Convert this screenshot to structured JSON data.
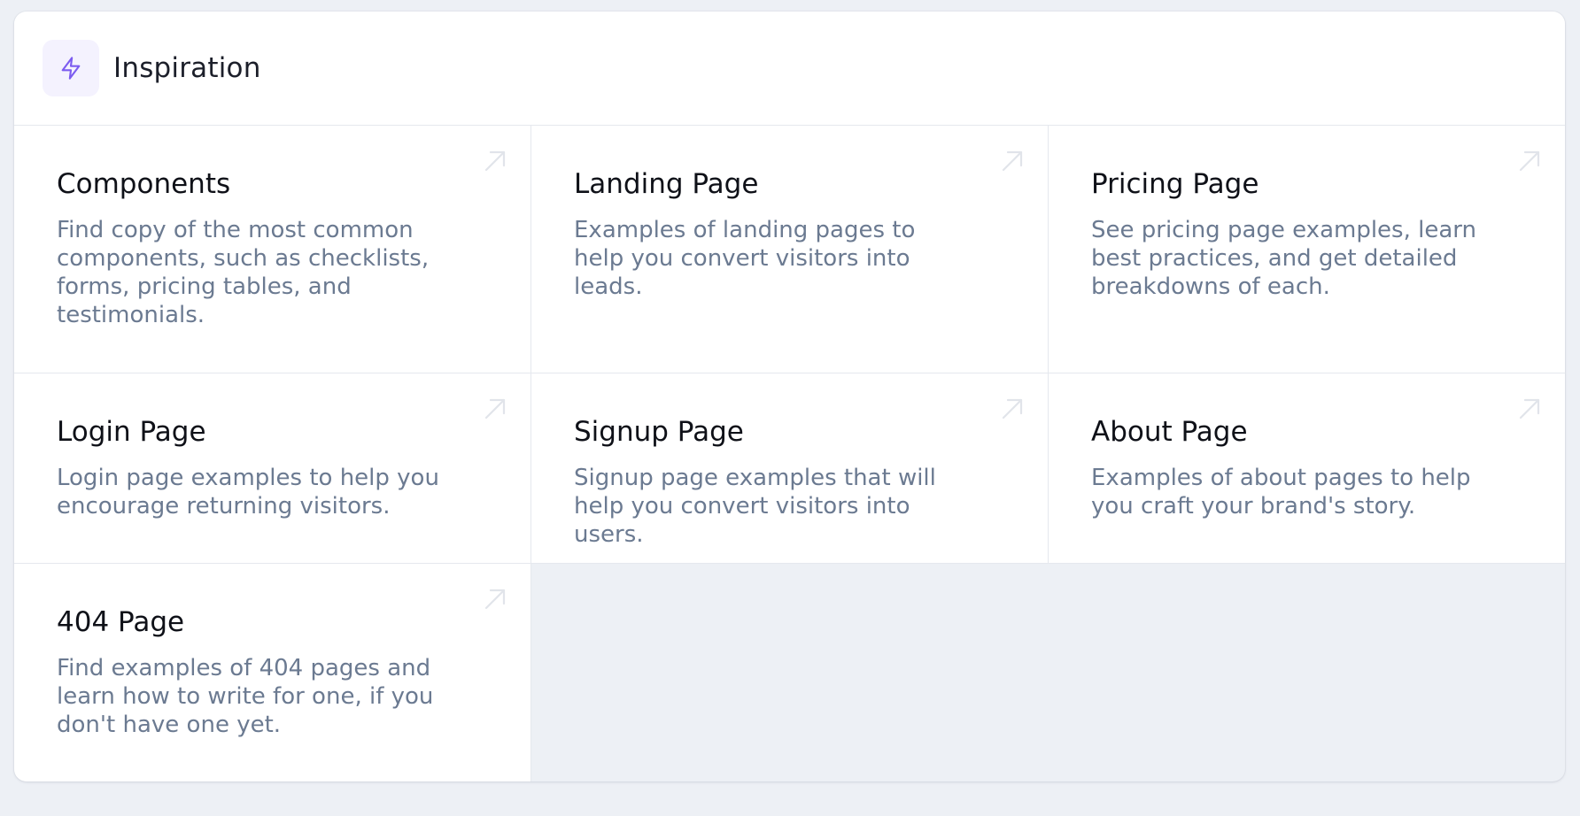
{
  "header": {
    "title": "Inspiration",
    "icon": "lightning-bolt-icon",
    "accent_color": "#7c5cf0"
  },
  "cards": [
    {
      "title": "Components",
      "description": "Find copy of the most common components, such as checklists, forms, pricing tables, and testimonials.",
      "icon": "arrow-up-right-icon"
    },
    {
      "title": "Landing Page",
      "description": "Examples of landing pages to help you convert visitors into leads.",
      "icon": "arrow-up-right-icon"
    },
    {
      "title": "Pricing Page",
      "description": "See pricing page examples, learn best practices, and get detailed breakdowns of each.",
      "icon": "arrow-up-right-icon"
    },
    {
      "title": "Login Page",
      "description": "Login page examples to help you encourage returning visitors.",
      "icon": "arrow-up-right-icon"
    },
    {
      "title": "Signup Page",
      "description": "Signup page examples that will help you convert visitors into users.",
      "icon": "arrow-up-right-icon"
    },
    {
      "title": "About Page",
      "description": "Examples of about pages to help you craft your brand's story.",
      "icon": "arrow-up-right-icon"
    },
    {
      "title": "404 Page",
      "description": "Find examples of 404 pages and learn how to write for one, if you don't have one yet.",
      "icon": "arrow-up-right-icon"
    }
  ],
  "colors": {
    "background": "#edf0f5",
    "card_background": "#ffffff",
    "title_text": "#0f1118",
    "description_text": "#6b7a91",
    "divider": "#e5e8ee",
    "arrow": "#e3e6ec"
  }
}
